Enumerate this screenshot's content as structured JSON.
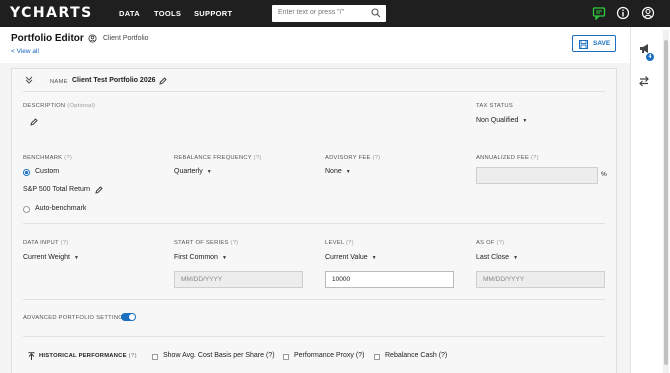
{
  "nav": {
    "logo": "YCHARTS",
    "links": [
      "DATA",
      "TOOLS",
      "SUPPORT"
    ],
    "search_placeholder": "Enter text or press \"/\""
  },
  "header": {
    "title": "Portfolio Editor",
    "client_label": "Client Portfolio",
    "view_all": "< View all",
    "save_label": "SAVE"
  },
  "rail": {
    "notification_count": "4"
  },
  "form": {
    "name_label": "NAME",
    "name_value": "Client Test Portfolio 2026",
    "description_label": "DESCRIPTION",
    "description_optional": "(Optional)",
    "tax_status_label": "TAX STATUS",
    "tax_status_value": "Non Qualified",
    "benchmark_label": "BENCHMARK",
    "benchmark_custom": "Custom",
    "benchmark_value": "S&P 500 Total Return",
    "benchmark_auto": "Auto-benchmark",
    "rebalance_label": "REBALANCE FREQUENCY",
    "rebalance_value": "Quarterly",
    "advisory_label": "ADVISORY FEE",
    "advisory_value": "None",
    "annualized_label": "ANNUALIZED FEE",
    "annualized_unit": "%",
    "data_input_label": "DATA INPUT",
    "data_input_value": "Current Weight",
    "start_label": "START OF SERIES",
    "start_value": "First Common",
    "start_placeholder": "MM/DD/YYYY",
    "level_label": "LEVEL",
    "level_type_value": "Current Value",
    "level_value": "10000",
    "asof_label": "AS OF",
    "asof_value": "Last Close",
    "asof_placeholder": "MM/DD/YYYY",
    "help": "(?)",
    "advanced_label": "ADVANCED PORTFOLIO SETTINGS",
    "hist_label": "HISTORICAL PERFORMANCE",
    "cb_cost_basis": "Show Avg. Cost Basis per Share (?)",
    "cb_proxy": "Performance Proxy (?)",
    "cb_rebalance_cash": "Rebalance Cash (?)"
  },
  "colors": {
    "accent": "#1a6fc1",
    "topbar": "#1f1f1f",
    "notif_green": "#2ecc40"
  }
}
